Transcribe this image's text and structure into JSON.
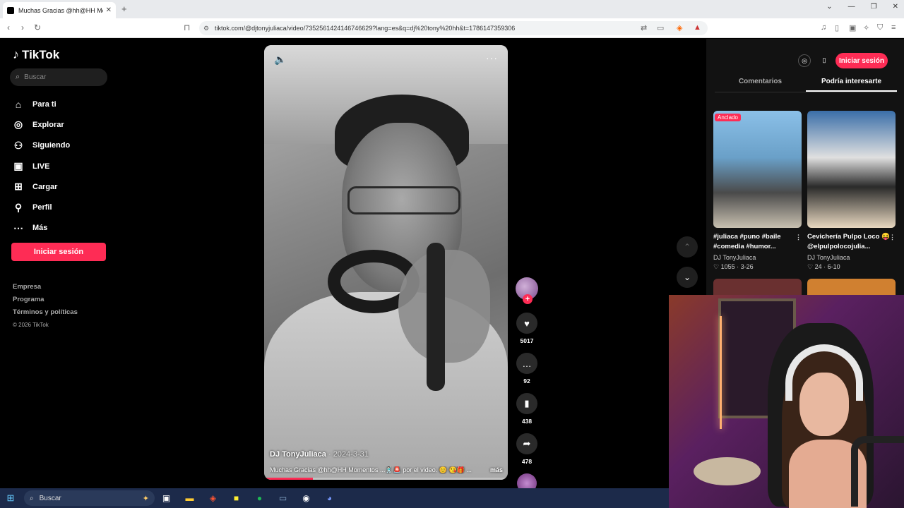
{
  "browser": {
    "tab_title": "Muchas Gracias @hh@HH Momen",
    "url": "tiktok.com/@djtonyjuliaca/video/7352561424146746629?lang=es&q=dj%20tony%20hh&t=1786147359306"
  },
  "sidebar": {
    "logo": "TikTok",
    "search_placeholder": "Buscar",
    "items": [
      {
        "label": "Para ti",
        "icon": "home-icon"
      },
      {
        "label": "Explorar",
        "icon": "compass-icon"
      },
      {
        "label": "Siguiendo",
        "icon": "following-icon"
      },
      {
        "label": "LIVE",
        "icon": "live-icon"
      },
      {
        "label": "Cargar",
        "icon": "upload-icon"
      },
      {
        "label": "Perfil",
        "icon": "profile-icon"
      },
      {
        "label": "Más",
        "icon": "more-icon"
      }
    ],
    "login_label": "Iniciar sesión",
    "footer": {
      "company": "Empresa",
      "program": "Programa",
      "terms": "Términos y políticas",
      "copyright": "© 2026 TikTok"
    }
  },
  "video": {
    "author": "DJ TonyJuliaca",
    "date": "2024-3-31",
    "caption": "Muchas Gracias @hh@HH Momentos ...🕺🏻🚨 por el video. 😊 😘🎁 ...",
    "more": "más",
    "progress": 0.2
  },
  "actions": {
    "likes": "5017",
    "comments": "92",
    "saves": "438",
    "shares": "478"
  },
  "right_panel": {
    "login_label": "Iniciar sesión",
    "tabs": [
      "Comentarios",
      "Podría interesarte"
    ],
    "active_tab": 1,
    "cards": [
      {
        "pin": "Anclado",
        "title": "#juliaca #puno #baile #comedia #humor...",
        "user": "DJ TonyJuliaca",
        "stats": "♡ 1055 · 3-26"
      },
      {
        "pin": "",
        "title": "Cevichería Pulpo Loco 😝 @elpulpolocojulia...",
        "user": "DJ TonyJuliaca",
        "stats": "♡ 24 · 6-10"
      }
    ]
  },
  "taskbar": {
    "search_label": "Buscar"
  }
}
